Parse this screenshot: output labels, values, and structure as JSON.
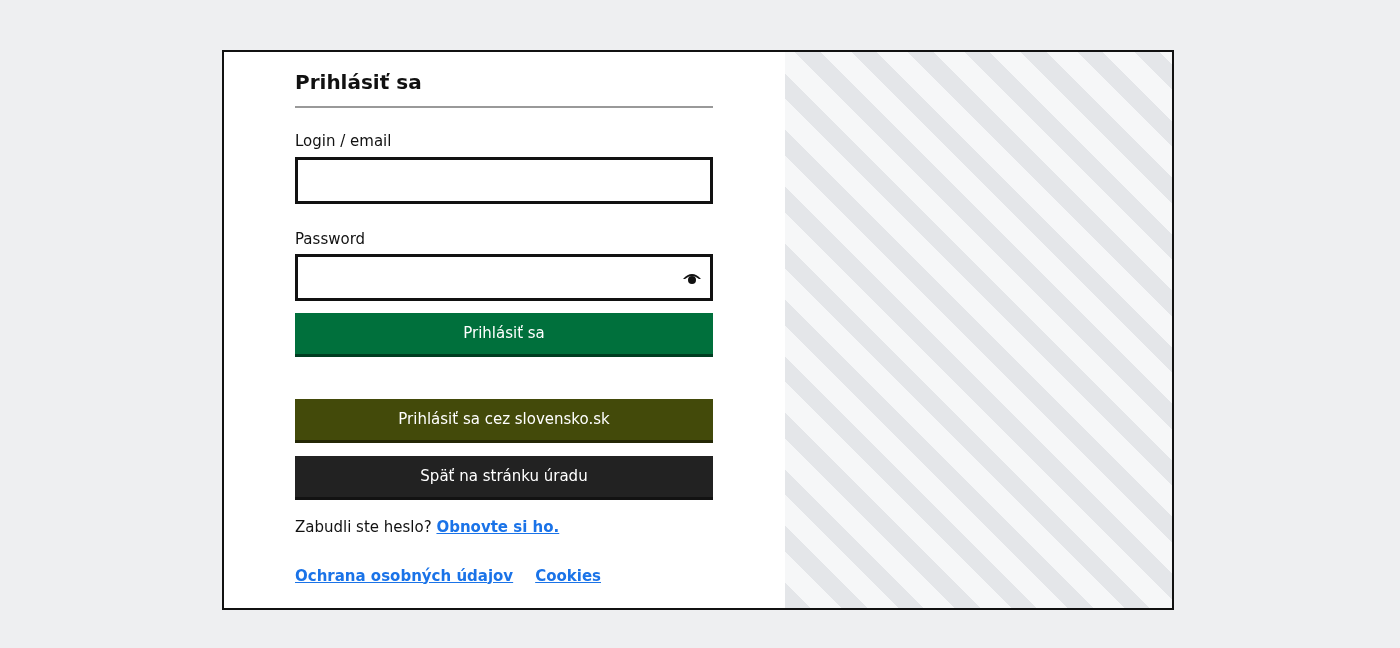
{
  "title": "Prihlásiť sa",
  "fields": [
    {
      "label": "Login / email",
      "kind": "text"
    },
    {
      "label": "Password",
      "kind": "password"
    }
  ],
  "buttons": [
    {
      "label": "Prihlásiť sa",
      "kind": "primary"
    },
    {
      "label": "Prihlásiť sa cez slovensko.sk",
      "kind": "external"
    },
    {
      "label": "Späť na stránku úradu",
      "kind": "back"
    }
  ],
  "forgot": {
    "text": "Zabudli ste heslo?",
    "link": "Obnovte si ho."
  },
  "footer_links": [
    "Ochrana osobných údajov",
    "Cookies"
  ]
}
